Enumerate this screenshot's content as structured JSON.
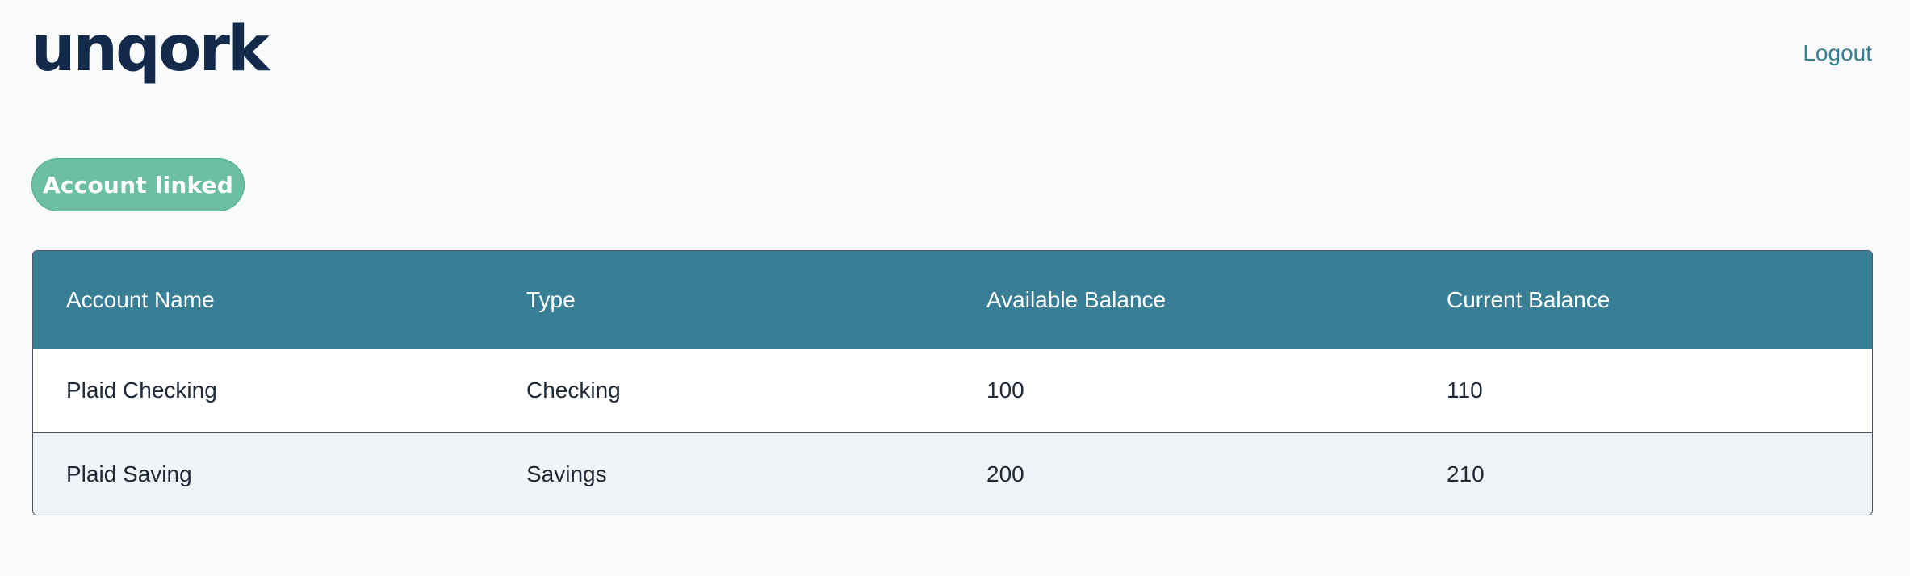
{
  "header": {
    "logo_text": "unqork",
    "logout_label": "Logout"
  },
  "status_badge": {
    "label": "Account linked",
    "color": "#6cbfa0"
  },
  "accounts_table": {
    "header_color": "#387f95",
    "columns": [
      "Account Name",
      "Type",
      "Available Balance",
      "Current Balance"
    ],
    "rows": [
      [
        "Plaid Checking",
        "Checking",
        "100",
        "110"
      ],
      [
        "Plaid Saving",
        "Savings",
        "200",
        "210"
      ]
    ]
  }
}
